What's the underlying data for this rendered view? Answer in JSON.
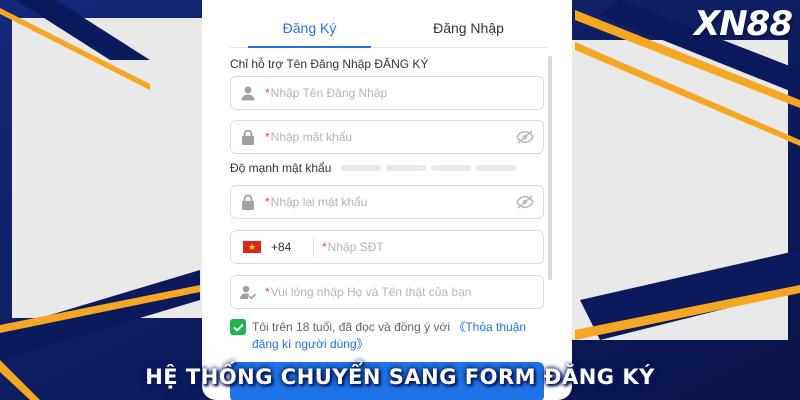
{
  "brand": {
    "logo": "XN88"
  },
  "colors": {
    "accent": "#1e73e8",
    "required": "#e54545",
    "checked": "#1eb44b",
    "background_dark": "#0b1a5c",
    "stripe": "#f5a623"
  },
  "tabs": [
    {
      "label": "Đăng Ký",
      "active": true
    },
    {
      "label": "Đăng Nhập",
      "active": false
    }
  ],
  "form": {
    "hint": "Chỉ hỗ trợ Tên Đăng Nhập ĐĂNG KÝ",
    "username": {
      "icon": "user-icon",
      "required_mark": "*",
      "placeholder": "Nhập Tên Đăng Nhập"
    },
    "password": {
      "icon": "lock-icon",
      "required_mark": "*",
      "placeholder": "Nhập mật khẩu",
      "toggle_icon": "eye-off-icon"
    },
    "strength": {
      "label": "Độ mạnh mật khẩu",
      "segments": 4
    },
    "confirm_password": {
      "icon": "lock-icon",
      "required_mark": "*",
      "placeholder": "Nhập lại mật khẩu",
      "toggle_icon": "eye-off-icon"
    },
    "phone": {
      "flag": "vietnam-flag-icon",
      "country_code": "+84",
      "required_mark": "*",
      "placeholder": "Nhập SĐT"
    },
    "fullname": {
      "icon": "user-check-icon",
      "required_mark": "*",
      "placeholder": "Vui lòng nhập Họ và Tên thật của bạn"
    },
    "agreement": {
      "checked": true,
      "text": "Tôi trên 18 tuổi, đã đọc và đồng ý với ",
      "link": "《Thỏa thuận đăng kí người dùng》"
    }
  },
  "caption": "HỆ THỐNG CHUYỂN SANG FORM ĐĂNG KÝ"
}
